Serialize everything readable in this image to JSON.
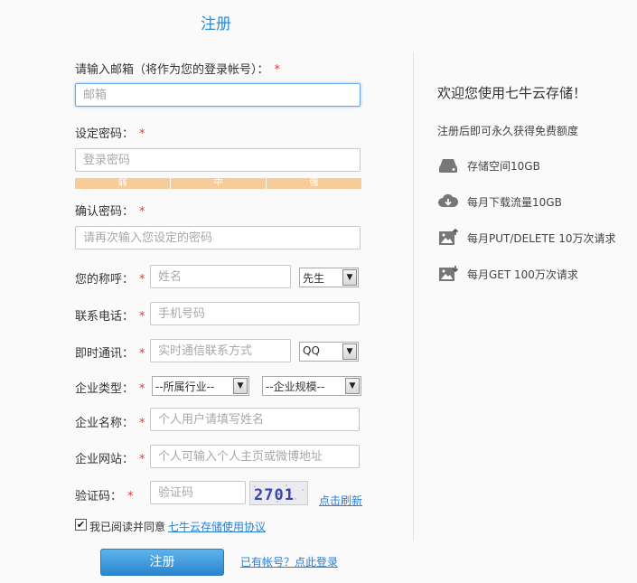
{
  "page_title": "注册",
  "form": {
    "email": {
      "label": "请输入邮箱（将作为您的登录帐号）：",
      "placeholder": "邮箱"
    },
    "password": {
      "label": "设定密码：",
      "placeholder": "登录密码",
      "strength": [
        "弱",
        "中",
        "强"
      ]
    },
    "confirm": {
      "label": "确认密码：",
      "placeholder": "请再次输入您设定的密码"
    },
    "name": {
      "label": "您的称呼：",
      "placeholder": "姓名",
      "title_select": "先生"
    },
    "phone": {
      "label": "联系电话：",
      "placeholder": "手机号码"
    },
    "im": {
      "label": "即时通讯：",
      "placeholder": "实时通信联系方式",
      "im_select": "QQ"
    },
    "company_type": {
      "label": "企业类型：",
      "industry_select": "--所属行业--",
      "size_select": "--企业规模--"
    },
    "company_name": {
      "label": "企业名称：",
      "placeholder": "个人用户请填写姓名"
    },
    "website": {
      "label": "企业网站：",
      "placeholder": "个人可输入个人主页或微博地址"
    },
    "captcha": {
      "label": "验证码：",
      "placeholder": "验证码",
      "image_text": "2701",
      "refresh_link": "点击刷新"
    },
    "required_mark": "*",
    "agree": {
      "checked": true,
      "text": "我已阅读并同意",
      "link": "七牛云存储使用协议"
    },
    "submit_label": "注册",
    "login_link": "已有帐号？点此登录"
  },
  "aside": {
    "title": "欢迎您使用七牛云存储！",
    "subtitle": "注册后即可永久获得免费额度",
    "features": [
      {
        "icon": "storage-icon",
        "text": "存储空间10GB"
      },
      {
        "icon": "cloud-download-icon",
        "text": "每月下载流量10GB"
      },
      {
        "icon": "image-upload-icon",
        "text": "每月PUT/DELETE 10万次请求"
      },
      {
        "icon": "image-get-icon",
        "text": "每月GET 100万次请求"
      }
    ]
  },
  "colors": {
    "accent": "#2b8ad4",
    "required": "#e4393c",
    "strength_bar": "#f8cc99"
  }
}
